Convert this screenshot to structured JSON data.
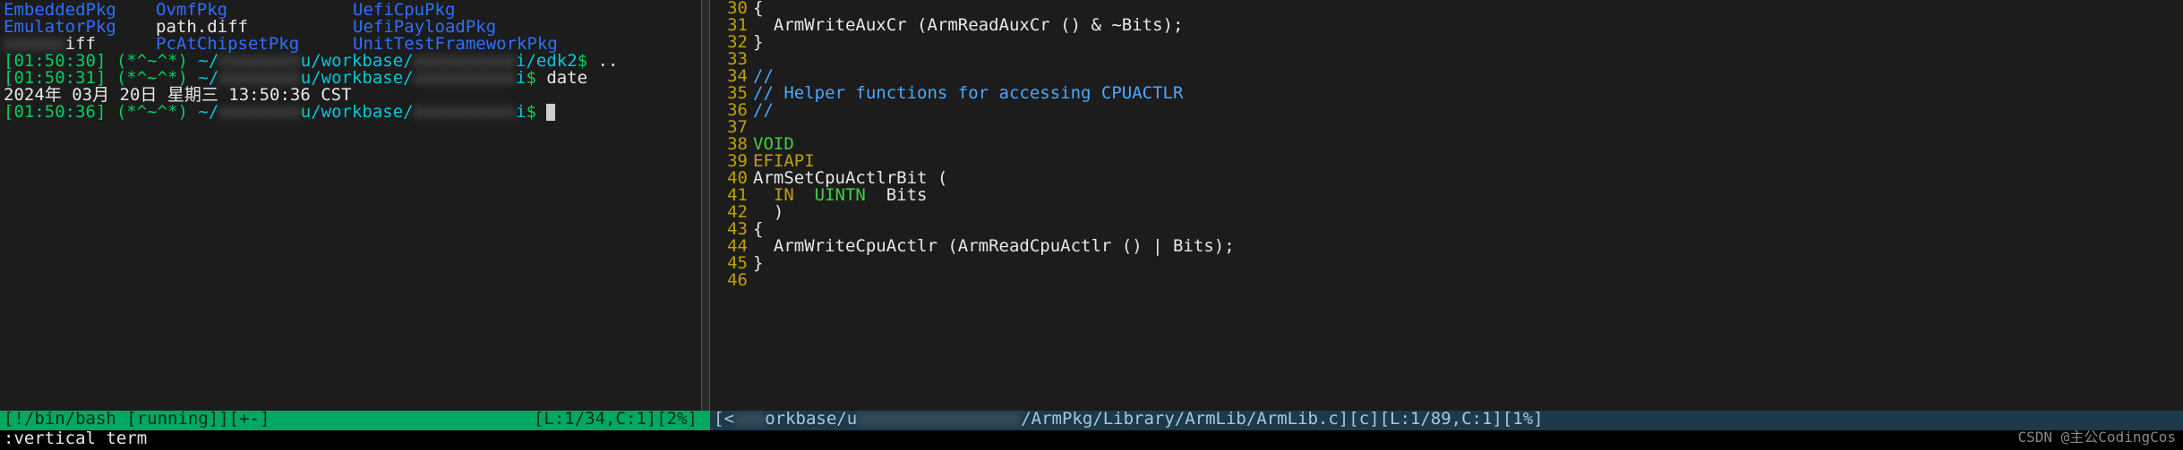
{
  "terminal": {
    "ls": {
      "row1": {
        "a": "EmbeddedPkg",
        "b": "OvmfPkg",
        "c": "UefiCpuPkg"
      },
      "row2": {
        "a": "EmulatorPkg",
        "b": "path.diff",
        "c": "UefiPayloadPkg"
      },
      "row3": {
        "a_blur": "xxxxxx",
        "a_suffix": "iff",
        "b": "PcAtChipsetPkg",
        "c": "UnitTestFrameworkPkg"
      }
    },
    "prompt1": {
      "ts": "[01:50:30]",
      "face": "(*^~^*)",
      "tilde": "~/",
      "blur1": "xxxxxxxx",
      "mid1": "u/workbase/",
      "blur2": "xxxxxxxxxx",
      "mid2": "i/edk2",
      "dollar": "$",
      "cmd": " .."
    },
    "prompt2": {
      "ts": "[01:50:31]",
      "face": "(*^~^*)",
      "tilde": "~/",
      "blur1": "xxxxxxxx",
      "mid1": "u/workbase/",
      "blur2": "xxxxxxxxxx",
      "mid2": "i",
      "dollar": "$",
      "cmd": " date"
    },
    "date_out": "2024年 03月 20日 星期三 13:50:36 CST",
    "prompt3": {
      "ts": "[01:50:36]",
      "face": "(*^~^*)",
      "tilde": "~/",
      "blur1": "xxxxxxxx",
      "mid1": "u/workbase/",
      "blur2": "xxxxxxxxxx",
      "mid2": "i",
      "dollar": "$"
    }
  },
  "code": {
    "lines": {
      "30": "{",
      "31": "  ArmWriteAuxCr (ArmReadAuxCr () & ~Bits);",
      "32": "}",
      "33": "",
      "34": "//",
      "35": "// Helper functions for accessing CPUACTLR",
      "36": "//",
      "37": "",
      "38_a": "VOID",
      "39_a": "EFIAPI",
      "40": "ArmSetCpuActlrBit (",
      "41_a": "  IN",
      "41_b": "  UINTN",
      "41_c": "  Bits",
      "42": "  )",
      "43": "{",
      "44": "  ArmWriteCpuActlr (ArmReadCpuActlr () | Bits);",
      "45": "}",
      "46": ""
    },
    "linenos": [
      "30",
      "31",
      "32",
      "33",
      "34",
      "35",
      "36",
      "37",
      "38",
      "39",
      "40",
      "41",
      "42",
      "43",
      "44",
      "45",
      "46"
    ]
  },
  "status": {
    "left_a": "[!/bin/bash [running]][+-]",
    "left_b": "[L:1/34,C:1][2%]",
    "right_a_pre": "[<",
    "right_a_blur": "xxx",
    "right_a_mid1": "orkbase/u",
    "right_a_blur2": "xxxxxxxxxxxxxxxx",
    "right_a_mid2": "/ArmPkg/Library/ArmLib/ArmLib.c][c][L:1/89,C:1][1%]"
  },
  "cmd": {
    "text": ":vertical term"
  },
  "watermark": "CSDN @主公CodingCos"
}
